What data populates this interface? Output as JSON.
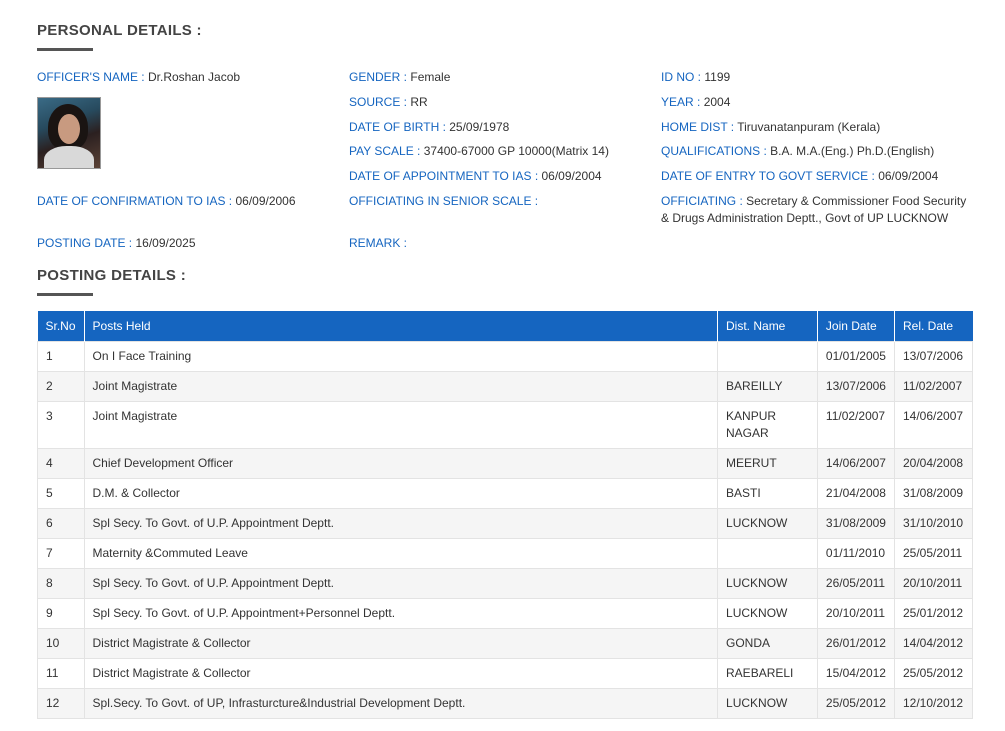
{
  "personal": {
    "heading": "PERSONAL DETAILS :",
    "officer_name_label": "OFFICER'S NAME :",
    "officer_name": "Dr.Roshan Jacob",
    "gender_label": "GENDER :",
    "gender": "Female",
    "id_no_label": "ID NO :",
    "id_no": "1199",
    "source_label": "SOURCE :",
    "source": "RR",
    "year_label": "YEAR :",
    "year": "2004",
    "dob_label": "DATE OF BIRTH :",
    "dob": "25/09/1978",
    "home_dist_label": "HOME DIST :",
    "home_dist": "Tiruvanatanpuram (Kerala)",
    "pay_scale_label": "PAY SCALE :",
    "pay_scale": "37400-67000 GP 10000(Matrix 14)",
    "qualifications_label": "QUALIFICATIONS :",
    "qualifications": "B.A. M.A.(Eng.) Ph.D.(English)",
    "appointment_label": "DATE OF APPOINTMENT TO IAS :",
    "appointment": "06/09/2004",
    "entry_label": "DATE OF ENTRY TO GOVT SERVICE :",
    "entry": "06/09/2004",
    "confirmation_label": "DATE OF CONFIRMATION TO IAS :",
    "confirmation": "06/09/2006",
    "senior_scale_label": "OFFICIATING IN SENIOR SCALE :",
    "senior_scale": "",
    "officiating_label": "OFFICIATING :",
    "officiating": "Secretary & Commissioner Food Security & Drugs Administration Deptt., Govt of UP LUCKNOW",
    "posting_date_label": "POSTING DATE :",
    "posting_date": "16/09/2025",
    "remark_label": "REMARK :",
    "remark": ""
  },
  "posting": {
    "heading": "POSTING DETAILS :",
    "columns": {
      "sr": "Sr.No",
      "post": "Posts Held",
      "dist": "Dist. Name",
      "join": "Join Date",
      "rel": "Rel. Date"
    },
    "rows": [
      {
        "sr": "1",
        "post": "On I Face Training",
        "dist": "",
        "join": "01/01/2005",
        "rel": "13/07/2006"
      },
      {
        "sr": "2",
        "post": "Joint Magistrate",
        "dist": "BAREILLY",
        "join": "13/07/2006",
        "rel": "11/02/2007"
      },
      {
        "sr": "3",
        "post": "Joint Magistrate",
        "dist": "KANPUR NAGAR",
        "join": "11/02/2007",
        "rel": "14/06/2007"
      },
      {
        "sr": "4",
        "post": "Chief Development Officer",
        "dist": "MEERUT",
        "join": "14/06/2007",
        "rel": "20/04/2008"
      },
      {
        "sr": "5",
        "post": "D.M. & Collector",
        "dist": "BASTI",
        "join": "21/04/2008",
        "rel": "31/08/2009"
      },
      {
        "sr": "6",
        "post": "Spl Secy. To Govt. of U.P. Appointment Deptt.",
        "dist": "LUCKNOW",
        "join": "31/08/2009",
        "rel": "31/10/2010"
      },
      {
        "sr": "7",
        "post": "Maternity &Commuted Leave",
        "dist": "",
        "join": "01/11/2010",
        "rel": "25/05/2011"
      },
      {
        "sr": "8",
        "post": "Spl Secy. To Govt. of U.P. Appointment Deptt.",
        "dist": "LUCKNOW",
        "join": "26/05/2011",
        "rel": "20/10/2011"
      },
      {
        "sr": "9",
        "post": "Spl Secy. To Govt. of U.P. Appointment+Personnel Deptt.",
        "dist": "LUCKNOW",
        "join": "20/10/2011",
        "rel": "25/01/2012"
      },
      {
        "sr": "10",
        "post": "District Magistrate & Collector",
        "dist": "GONDA",
        "join": "26/01/2012",
        "rel": "14/04/2012"
      },
      {
        "sr": "11",
        "post": "District Magistrate & Collector",
        "dist": "RAEBARELI",
        "join": "15/04/2012",
        "rel": "25/05/2012"
      },
      {
        "sr": "12",
        "post": "Spl.Secy. To Govt. of UP, Infrasturcture&Industrial Development Deptt.",
        "dist": "LUCKNOW",
        "join": "25/05/2012",
        "rel": "12/10/2012"
      }
    ]
  }
}
